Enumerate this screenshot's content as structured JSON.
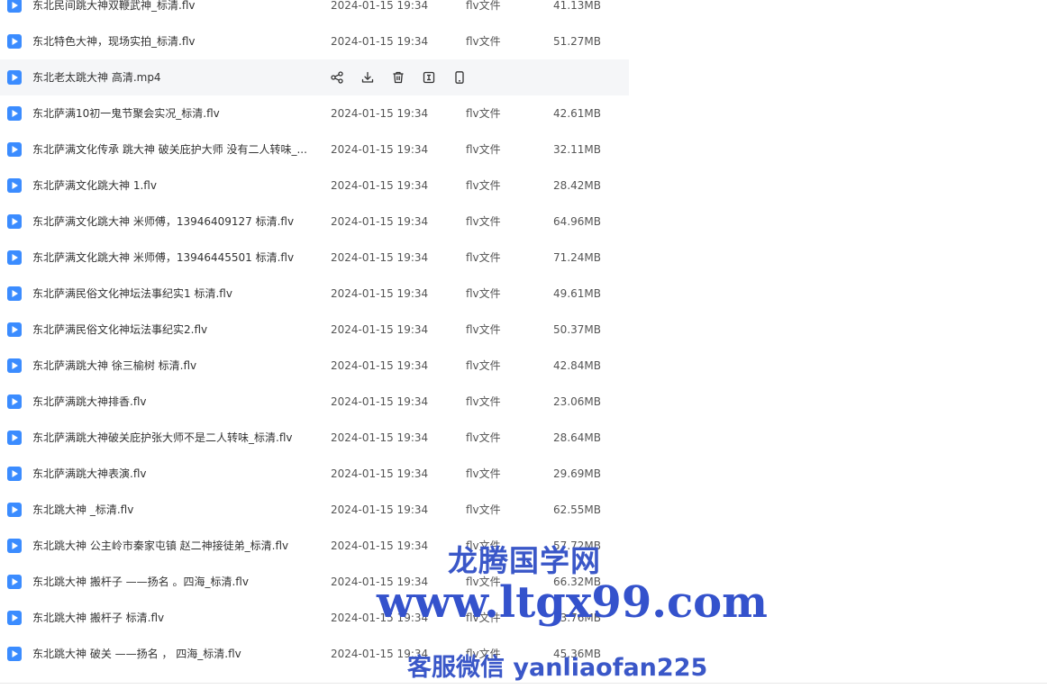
{
  "files": [
    {
      "name": "东北民间跳大神双鞭武神_标清.flv",
      "date": "2024-01-15 19:34",
      "type": "flv文件",
      "size": "41.13MB",
      "hovered": false
    },
    {
      "name": "东北特色大神，现场实拍_标清.flv",
      "date": "2024-01-15 19:34",
      "type": "flv文件",
      "size": "51.27MB",
      "hovered": false
    },
    {
      "name": "东北老太跳大神 高清.mp4",
      "date": "",
      "type": "",
      "size": "",
      "hovered": true
    },
    {
      "name": "东北萨满10初一鬼节聚会实况_标清.flv",
      "date": "2024-01-15 19:34",
      "type": "flv文件",
      "size": "42.61MB",
      "hovered": false
    },
    {
      "name": "东北萨满文化传承 跳大神 破关庇护大师 没有二人转味_...",
      "date": "2024-01-15 19:34",
      "type": "flv文件",
      "size": "32.11MB",
      "hovered": false
    },
    {
      "name": "东北萨满文化跳大神 1.flv",
      "date": "2024-01-15 19:34",
      "type": "flv文件",
      "size": "28.42MB",
      "hovered": false
    },
    {
      "name": "东北萨满文化跳大神 米师傅，13946409127 标清.flv",
      "date": "2024-01-15 19:34",
      "type": "flv文件",
      "size": "64.96MB",
      "hovered": false
    },
    {
      "name": "东北萨满文化跳大神 米师傅，13946445501 标清.flv",
      "date": "2024-01-15 19:34",
      "type": "flv文件",
      "size": "71.24MB",
      "hovered": false
    },
    {
      "name": "东北萨满民俗文化神坛法事纪实1 标清.flv",
      "date": "2024-01-15 19:34",
      "type": "flv文件",
      "size": "49.61MB",
      "hovered": false
    },
    {
      "name": "东北萨满民俗文化神坛法事纪实2.flv",
      "date": "2024-01-15 19:34",
      "type": "flv文件",
      "size": "50.37MB",
      "hovered": false
    },
    {
      "name": "东北萨满跳大神 徐三榆树 标清.flv",
      "date": "2024-01-15 19:34",
      "type": "flv文件",
      "size": "42.84MB",
      "hovered": false
    },
    {
      "name": "东北萨满跳大神排香.flv",
      "date": "2024-01-15 19:34",
      "type": "flv文件",
      "size": "23.06MB",
      "hovered": false
    },
    {
      "name": "东北萨满跳大神破关庇护张大师不是二人转味_标清.flv",
      "date": "2024-01-15 19:34",
      "type": "flv文件",
      "size": "28.64MB",
      "hovered": false
    },
    {
      "name": "东北萨满跳大神表演.flv",
      "date": "2024-01-15 19:34",
      "type": "flv文件",
      "size": "29.69MB",
      "hovered": false
    },
    {
      "name": "东北跳大神 _标清.flv",
      "date": "2024-01-15 19:34",
      "type": "flv文件",
      "size": "62.55MB",
      "hovered": false
    },
    {
      "name": "东北跳大神 公主岭市秦家屯镇 赵二神接徒弟_标清.flv",
      "date": "2024-01-15 19:34",
      "type": "flv文件",
      "size": "57.72MB",
      "hovered": false
    },
    {
      "name": "东北跳大神 搬杆子 ——扬名 。四海_标清.flv",
      "date": "2024-01-15 19:34",
      "type": "flv文件",
      "size": "66.32MB",
      "hovered": false
    },
    {
      "name": "东北跳大神 搬杆子 标清.flv",
      "date": "2024-01-15 19:34",
      "type": "flv文件",
      "size": "63.76MB",
      "hovered": false
    },
    {
      "name": "东北跳大神 破关 ——扬名 ， 四海_标清.flv",
      "date": "2024-01-15 19:34",
      "type": "flv文件",
      "size": "45.36MB",
      "hovered": false
    }
  ],
  "hover_actions": [
    {
      "id": "share",
      "icon": "share-icon"
    },
    {
      "id": "download",
      "icon": "download-icon"
    },
    {
      "id": "delete",
      "icon": "trash-icon"
    },
    {
      "id": "rename",
      "icon": "rename-icon"
    },
    {
      "id": "mobile",
      "icon": "mobile-icon"
    }
  ],
  "watermark": {
    "title": "龙腾国学网",
    "url": "www.ltgx99.com",
    "wechat": "客服微信 yanliaofan225"
  },
  "colors": {
    "file_icon": "#3b8cff",
    "hover_row": "#f5f6f8",
    "watermark": "#3a57c8"
  }
}
